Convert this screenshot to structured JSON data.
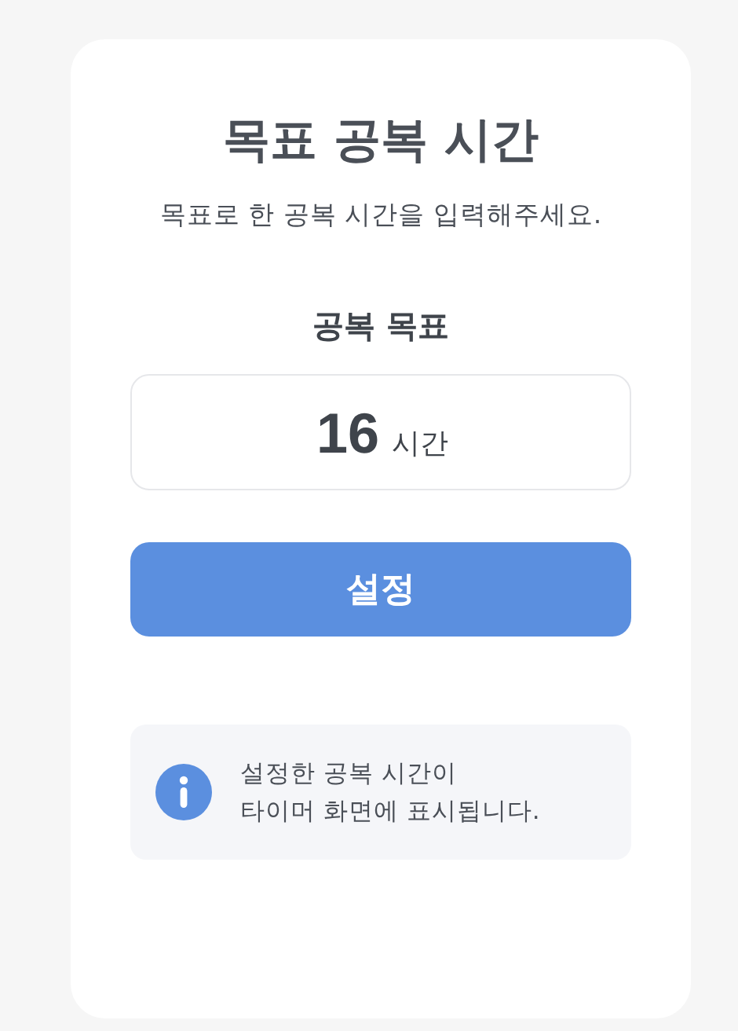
{
  "title": "목표 공복 시간",
  "subtitle": "목표로 한 공복 시간을 입력해주세요.",
  "goal": {
    "label": "공복 목표",
    "value": "16",
    "unit": "시간"
  },
  "button": "설정",
  "info": {
    "lines": [
      "설정한 공복 시간이",
      "타이머 화면에 표시됩니다."
    ]
  }
}
